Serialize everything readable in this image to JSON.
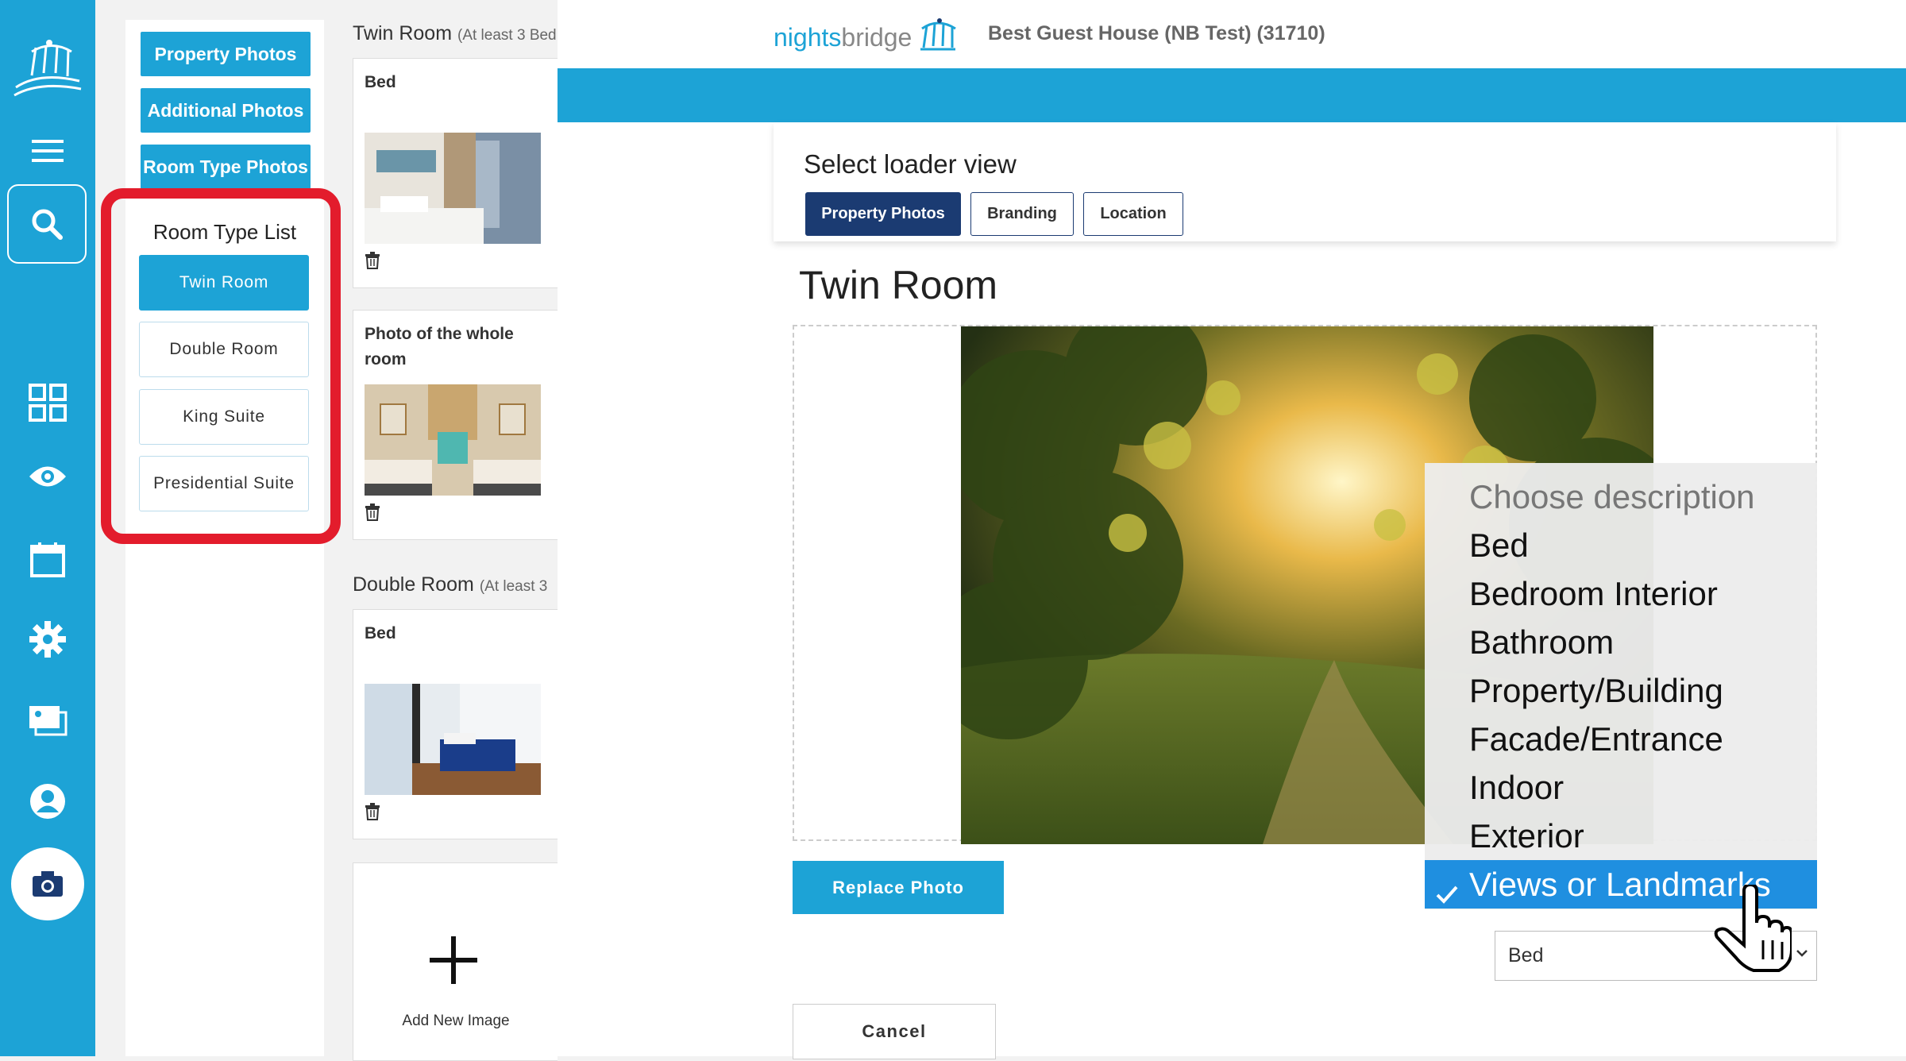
{
  "colors": {
    "brand_blue": "#1da3d6",
    "navy": "#1b3b72",
    "highlight_red": "#e31c2c",
    "dropdown_selected": "#1f8fe0"
  },
  "rail": {
    "icons": [
      "logo-icon",
      "menu-icon",
      "search-icon",
      "grid-icon",
      "eye-icon",
      "calendar-icon",
      "gear-icon",
      "gallery-icon",
      "user-icon",
      "camera-icon"
    ]
  },
  "nav": {
    "property_photos": "Property Photos",
    "additional_photos": "Additional Photos",
    "room_type_photos": "Room Type Photos"
  },
  "room_type_list": {
    "title": "Room Type List",
    "items": [
      "Twin Room",
      "Double Room",
      "King Suite",
      "Presidential Suite"
    ],
    "active": "Twin Room"
  },
  "sections": [
    {
      "name": "Twin Room",
      "note": "(At least 3 Bed",
      "cards": [
        {
          "label": "Bed"
        },
        {
          "label": "Photo of the whole room"
        }
      ]
    },
    {
      "name": "Double Room",
      "note": "(At least 3",
      "cards": [
        {
          "label": "Bed"
        }
      ]
    }
  ],
  "add_new_image": "Add New Image",
  "header": {
    "brand_a": "nights",
    "brand_b": "bridge",
    "property_name": "Best Guest House (NB Test) (31710)"
  },
  "loader": {
    "title": "Select loader view",
    "tabs": [
      "Property Photos",
      "Branding",
      "Location"
    ],
    "active_tab": "Property Photos"
  },
  "room_title": "Twin Room",
  "buttons": {
    "replace": "Replace Photo",
    "cancel": "Cancel"
  },
  "description_select": {
    "value": "Bed",
    "options": [
      "Choose description",
      "Bed",
      "Bedroom Interior",
      "Bathroom",
      "Property/Building",
      "Facade/Entrance",
      "Indoor",
      "Exterior",
      "Views or Landmarks"
    ],
    "highlighted": "Views or Landmarks"
  }
}
